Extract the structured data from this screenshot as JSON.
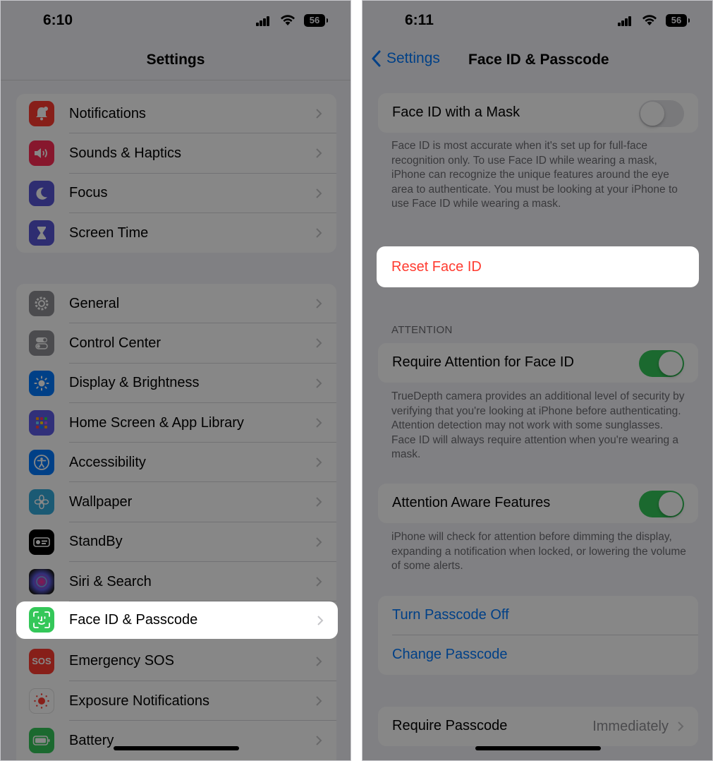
{
  "left": {
    "status": {
      "time": "6:10",
      "battery": "56"
    },
    "title": "Settings",
    "group1": [
      {
        "label": "Notifications",
        "icon": "bell-icon",
        "color": "#ff3b30"
      },
      {
        "label": "Sounds & Haptics",
        "icon": "speaker-icon",
        "color": "#ff2d55"
      },
      {
        "label": "Focus",
        "icon": "moon-icon",
        "color": "#5856d6"
      },
      {
        "label": "Screen Time",
        "icon": "hourglass-icon",
        "color": "#5856d6"
      }
    ],
    "group2": [
      {
        "label": "General",
        "icon": "gear-icon",
        "color": "#8e8e93"
      },
      {
        "label": "Control Center",
        "icon": "switches-icon",
        "color": "#8e8e93"
      },
      {
        "label": "Display & Brightness",
        "icon": "sun-icon",
        "color": "#007aff"
      },
      {
        "label": "Home Screen & App Library",
        "icon": "grid-icon",
        "color": "#5e5ce6"
      },
      {
        "label": "Accessibility",
        "icon": "accessibility-icon",
        "color": "#007aff"
      },
      {
        "label": "Wallpaper",
        "icon": "flower-icon",
        "color": "#34aadc"
      },
      {
        "label": "StandBy",
        "icon": "standby-icon",
        "color": "#000000"
      },
      {
        "label": "Siri & Search",
        "icon": "siri-icon",
        "color": "#1c1c1e"
      },
      {
        "label": "Face ID & Passcode",
        "icon": "face-id-icon",
        "color": "#34c759"
      },
      {
        "label": "Emergency SOS",
        "icon": "sos-icon",
        "color": "#ff3b30",
        "icon_text": "SOS"
      },
      {
        "label": "Exposure Notifications",
        "icon": "exposure-icon",
        "color": "#ffffff"
      },
      {
        "label": "Battery",
        "icon": "battery-icon",
        "color": "#34c759"
      }
    ]
  },
  "right": {
    "status": {
      "time": "6:11",
      "battery": "56"
    },
    "back_label": "Settings",
    "title": "Face ID & Passcode",
    "mask_label": "Face ID with a Mask",
    "mask_footnote": "Face ID is most accurate when it's set up for full-face recognition only. To use Face ID while wearing a mask, iPhone can recognize the unique features around the eye area to authenticate. You must be looking at your iPhone to use Face ID while wearing a mask.",
    "reset_label": "Reset Face ID",
    "attention_header": "ATTENTION",
    "require_attention_label": "Require Attention for Face ID",
    "require_attention_footnote": "TrueDepth camera provides an additional level of security by verifying that you're looking at iPhone before authenticating. Attention detection may not work with some sunglasses. Face ID will always require attention when you're wearing a mask.",
    "aware_label": "Attention Aware Features",
    "aware_footnote": "iPhone will check for attention before dimming the display, expanding a notification when locked, or lowering the volume of some alerts.",
    "turn_off_label": "Turn Passcode Off",
    "change_label": "Change Passcode",
    "require_passcode_label": "Require Passcode",
    "require_passcode_value": "Immediately"
  },
  "colors": {
    "accent": "#007aff",
    "destructive": "#ff3b30",
    "toggle_on": "#34c759"
  }
}
